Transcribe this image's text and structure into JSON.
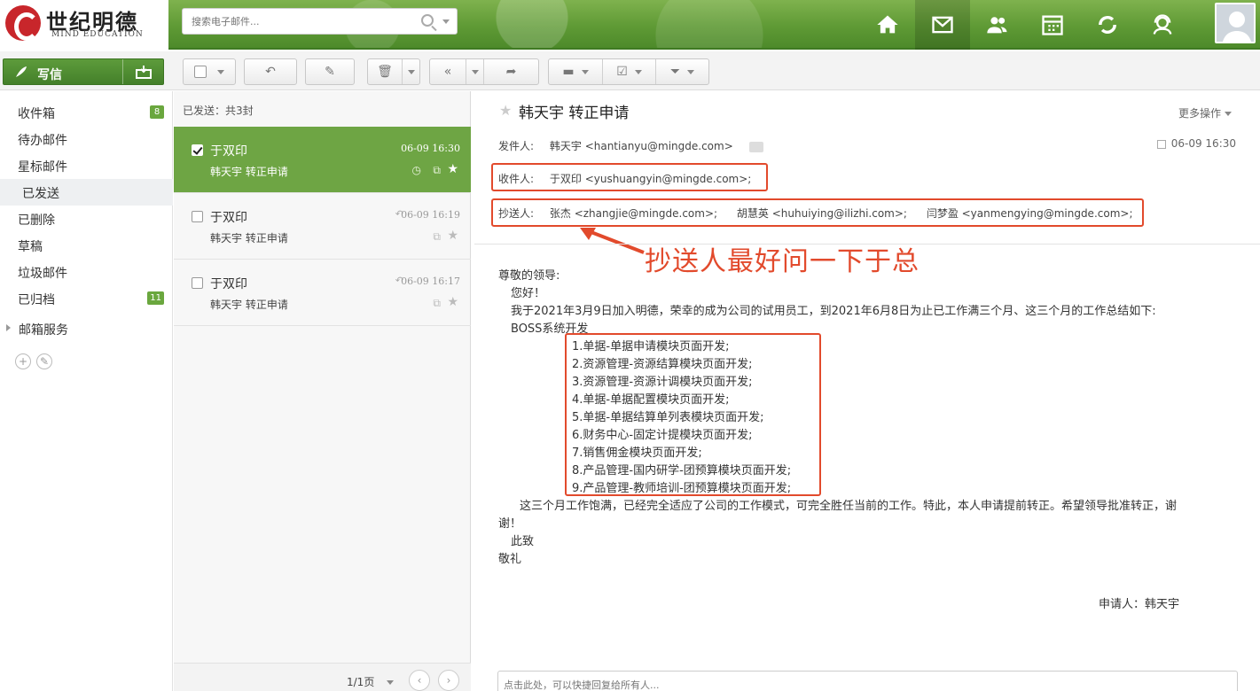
{
  "brand": {
    "name": "世纪明德",
    "sub": "MIND EDUCATION"
  },
  "search": {
    "placeholder": "搜索电子邮件..."
  },
  "compose": {
    "label": "写信"
  },
  "folders": [
    {
      "label": "收件箱",
      "badge": "8"
    },
    {
      "label": "待办邮件",
      "badge": ""
    },
    {
      "label": "星标邮件",
      "badge": ""
    },
    {
      "label": "已发送",
      "badge": ""
    },
    {
      "label": "已删除",
      "badge": ""
    },
    {
      "label": "草稿",
      "badge": ""
    },
    {
      "label": "垃圾邮件",
      "badge": ""
    },
    {
      "label": "已归档",
      "badge": "11"
    },
    {
      "label": "邮箱服务",
      "badge": ""
    }
  ],
  "list": {
    "header": "已发送：共3封",
    "items": [
      {
        "from": "于双印",
        "subject": "韩天宇 转正申请",
        "time": "06-09 16:30"
      },
      {
        "from": "于双印",
        "subject": "韩天宇 转正申请",
        "time": "06-09 16:19"
      },
      {
        "from": "于双印",
        "subject": "韩天宇 转正申请",
        "time": "06-09 16:17"
      }
    ],
    "pager": "1/1页"
  },
  "mail": {
    "subject": "韩天宇 转正申请",
    "more_actions": "更多操作",
    "from_label": "发件人:",
    "from_value": "韩天宇 <hantianyu@mingde.com>",
    "date": "06-09 16:30",
    "to_label": "收件人:",
    "to_value": "于双印 <yushuangyin@mingde.com>;",
    "cc_label": "抄送人:",
    "cc": [
      "张杰 <zhangjie@mingde.com>;",
      "胡慧英 <huhuiying@ilizhi.com>;",
      "闫梦盈 <yanmengying@mingde.com>;"
    ],
    "annotation": "抄送人最好问一下于总",
    "body": {
      "greeting": "尊敬的领导:",
      "hello": "您好！",
      "intro": "我于2021年3月9日加入明德，荣幸的成为公司的试用员工，到2021年6月8日为止已工作满三个月、这三个月的工作总结如下:",
      "project": "BOSS系统开发",
      "items": [
        "1.单据-单据申请模块页面开发;",
        "2.资源管理-资源结算模块页面开发;",
        "3.资源管理-资源计调模块页面开发;",
        "4.单据-单据配置模块页面开发;",
        "5.单据-单据结算单列表模块页面开发;",
        "6.财务中心-固定计提模块页面开发;",
        "7.销售佣金模块页面开发;",
        "8.产品管理-国内研学-团预算模块页面开发;",
        "9.产品管理-教师培训-团预算模块页面开发;"
      ],
      "para1": "这三个月工作饱满，已经完全适应了公司的工作模式，可完全胜任当前的工作。特此，本人申请提前转正。希望领导批准转正，谢",
      "para2": "谢！",
      "closing1": "此致",
      "closing2": "敬礼",
      "signature": "申请人：韩天宇"
    },
    "quick_reply_placeholder": "点击此处，可以快捷回复给所有人..."
  },
  "colors": {
    "accent": "#6ea544",
    "annotation": "#e24a2c"
  }
}
